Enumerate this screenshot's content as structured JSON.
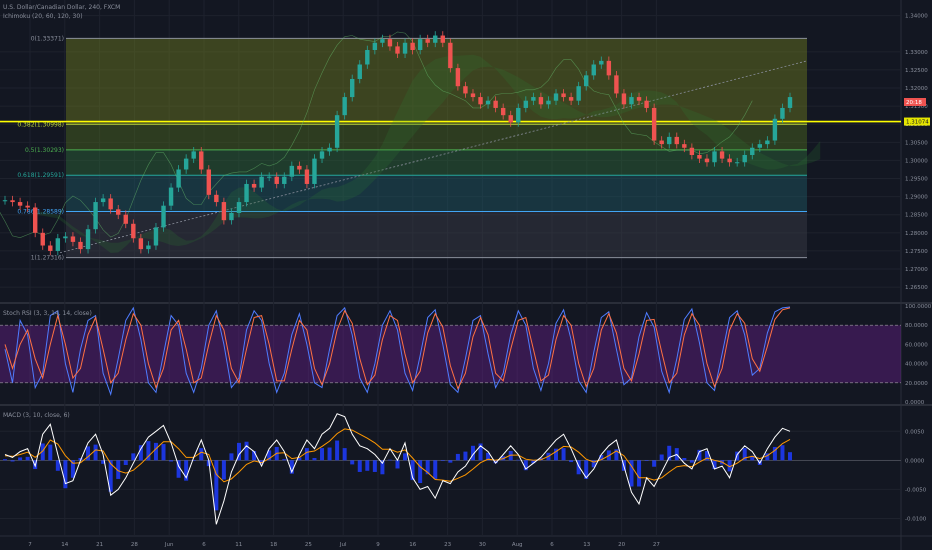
{
  "header": {
    "title": "U.S. Dollar/Canadian Dollar, 240, FXCM",
    "indicator": "Ichimoku (20, 60, 120, 30)"
  },
  "panes": {
    "stoch_label": "Stoch RSI (3, 3, 14, 14, close)",
    "macd_label": "MACD (3, 10, close, 6)"
  },
  "price_tags": {
    "upper": "20:18",
    "current": "1.31074"
  },
  "colors": {
    "background": "#131722",
    "candle_up": "#26a69a",
    "candle_down": "#ef5350",
    "horizontal_line": "#ffff00",
    "stoch_band": "#7b1fa2",
    "macd_line": "#ffffff",
    "signal_line": "#ff9800",
    "histogram": "#1e3cff"
  },
  "chart_data": [
    {
      "type": "line",
      "title": "U.S. Dollar/Canadian Dollar, 240, FXCM",
      "y_axis_ticks": [
        "1.34000",
        "1.33000",
        "1.32500",
        "1.32000",
        "1.31500",
        "1.31000",
        "1.30500",
        "1.30000",
        "1.29500",
        "1.29000",
        "1.28500",
        "1.28000",
        "1.27500",
        "1.27000",
        "1.26500"
      ],
      "ylim": [
        1.262,
        1.341
      ],
      "x_axis_ticks": [
        "7",
        "14",
        "21",
        "28",
        "Jun",
        "6",
        "11",
        "18",
        "25",
        "Jul",
        "9",
        "16",
        "23",
        "30",
        "Aug",
        "6",
        "13",
        "20",
        "27"
      ],
      "fib_levels": [
        {
          "label": "0(1.33371)",
          "value": 1.33371,
          "color": "#8a8f9c"
        },
        {
          "label": "0.382(1.30998)",
          "value": 1.30998,
          "color": "#bcd63a"
        },
        {
          "label": "0.5(1.30293)",
          "value": 1.30293,
          "color": "#4caf50"
        },
        {
          "label": "0.618(1.29591)",
          "value": 1.29591,
          "color": "#26a69a"
        },
        {
          "label": "0.786(1.28589)",
          "value": 1.28589,
          "color": "#42a5f5"
        },
        {
          "label": "1(1.27316)",
          "value": 1.27316,
          "color": "#8a8f9c"
        }
      ],
      "horizontal_line": 1.31074,
      "price_series": [
        1.289,
        1.2885,
        1.2875,
        1.287,
        1.28,
        1.2765,
        1.275,
        1.2785,
        1.279,
        1.2775,
        1.2755,
        1.281,
        1.2885,
        1.2895,
        1.2865,
        1.285,
        1.2825,
        1.2785,
        1.2755,
        1.2765,
        1.2815,
        1.2875,
        1.2925,
        1.2975,
        1.3005,
        1.3025,
        1.2975,
        1.2905,
        1.2885,
        1.2835,
        1.2855,
        1.2885,
        1.2935,
        1.2925,
        1.2955,
        1.2955,
        1.2935,
        1.2955,
        1.2985,
        1.2975,
        1.2935,
        1.3005,
        1.3025,
        1.3035,
        1.3125,
        1.3175,
        1.3225,
        1.3265,
        1.3305,
        1.3325,
        1.3335,
        1.3315,
        1.3295,
        1.3325,
        1.3305,
        1.3335,
        1.3325,
        1.3345,
        1.3325,
        1.3255,
        1.3205,
        1.3185,
        1.3175,
        1.3155,
        1.3165,
        1.3145,
        1.3125,
        1.3105,
        1.3145,
        1.3165,
        1.3175,
        1.3155,
        1.3165,
        1.3185,
        1.3175,
        1.3165,
        1.3205,
        1.3235,
        1.3265,
        1.3275,
        1.3235,
        1.3185,
        1.3155,
        1.3175,
        1.3165,
        1.3145,
        1.3055,
        1.3045,
        1.3065,
        1.3045,
        1.3035,
        1.3015,
        1.3005,
        1.2995,
        1.3025,
        1.3005,
        1.2995,
        1.2995,
        1.3015,
        1.3035,
        1.3045,
        1.3055,
        1.3115,
        1.3145,
        1.3175
      ]
    },
    {
      "type": "line",
      "title": "Stoch RSI (3, 3, 14, 14, close)",
      "y_axis_ticks": [
        "100.0000",
        "80.0000",
        "60.0000",
        "40.0000",
        "20.0000",
        "0.0000"
      ],
      "ylim": [
        0,
        100
      ],
      "band": [
        20,
        80
      ],
      "series": [
        {
          "name": "K",
          "color": "#4f7cff",
          "values": [
            55,
            20,
            85,
            70,
            15,
            30,
            90,
            95,
            40,
            10,
            55,
            85,
            90,
            30,
            8,
            45,
            85,
            98,
            65,
            20,
            10,
            50,
            90,
            80,
            30,
            10,
            35,
            80,
            95,
            60,
            15,
            25,
            75,
            95,
            85,
            40,
            10,
            30,
            70,
            92,
            60,
            20,
            15,
            55,
            90,
            98,
            70,
            25,
            10,
            40,
            80,
            95,
            75,
            30,
            12,
            48,
            88,
            96,
            60,
            18,
            10,
            45,
            85,
            90,
            50,
            15,
            30,
            70,
            95,
            80,
            35,
            12,
            40,
            82,
            96,
            65,
            22,
            10,
            52,
            88,
            94,
            55,
            18,
            25,
            68,
            93,
            78,
            32,
            10,
            45,
            86,
            97,
            62,
            20,
            12,
            50,
            88,
            95,
            70,
            28,
            35,
            72,
            94,
            98,
            99
          ]
        },
        {
          "name": "D",
          "color": "#ff7043",
          "values": [
            60,
            35,
            60,
            75,
            45,
            25,
            60,
            90,
            60,
            25,
            35,
            70,
            88,
            55,
            20,
            30,
            65,
            92,
            80,
            40,
            15,
            35,
            75,
            85,
            55,
            20,
            25,
            60,
            90,
            75,
            35,
            20,
            55,
            88,
            90,
            60,
            22,
            22,
            55,
            85,
            75,
            35,
            18,
            40,
            75,
            95,
            82,
            45,
            18,
            28,
            65,
            90,
            85,
            50,
            20,
            32,
            72,
            92,
            78,
            38,
            14,
            30,
            68,
            88,
            70,
            30,
            22,
            55,
            85,
            88,
            55,
            22,
            28,
            65,
            90,
            80,
            40,
            16,
            35,
            75,
            92,
            72,
            35,
            22,
            50,
            85,
            86,
            52,
            20,
            30,
            70,
            92,
            80,
            40,
            16,
            35,
            75,
            92,
            82,
            45,
            32,
            58,
            86,
            96,
            98
          ]
        }
      ]
    },
    {
      "type": "line",
      "title": "MACD (3, 10, close, 6)",
      "y_axis_ticks": [
        "0.0050",
        "0.0000",
        "-0.0050",
        "-0.0100"
      ],
      "ylim": [
        -0.0125,
        0.009
      ],
      "series": [
        {
          "name": "MACD",
          "color": "#ffffff",
          "values": [
            0.001,
            0.0005,
            0.0015,
            0.002,
            -0.001,
            0.0045,
            0.0062,
            0.001,
            -0.004,
            -0.0035,
            0.0,
            0.003,
            0.0045,
            0.001,
            -0.006,
            -0.005,
            -0.003,
            -0.0005,
            0.002,
            0.004,
            0.005,
            0.006,
            0.003,
            -0.001,
            -0.003,
            0.0005,
            0.0035,
            0.0,
            -0.011,
            -0.007,
            -0.002,
            0.001,
            0.0025,
            0.0015,
            -0.001,
            0.002,
            0.0035,
            0.0015,
            -0.002,
            0.001,
            0.0035,
            0.002,
            0.0045,
            0.0055,
            0.008,
            0.0075,
            0.0045,
            0.0025,
            0.002,
            0.001,
            -0.0005,
            0.002,
            0.0,
            0.003,
            -0.003,
            -0.005,
            -0.0045,
            -0.0065,
            -0.0035,
            -0.004,
            -0.002,
            -0.001,
            0.001,
            0.0025,
            0.0015,
            -0.0005,
            0.001,
            0.0025,
            0.001,
            -0.0015,
            -0.0005,
            0.0005,
            0.002,
            0.0035,
            0.0045,
            0.002,
            -0.001,
            -0.003,
            -0.0015,
            0.001,
            0.0025,
            0.0035,
            -0.001,
            -0.0055,
            -0.0075,
            -0.003,
            -0.0045,
            -0.002,
            0.0005,
            0.001,
            -0.0005,
            -0.0015,
            0.0015,
            0.002,
            -0.0015,
            -0.001,
            -0.003,
            0.001,
            0.0025,
            0.0015,
            -0.0005,
            0.002,
            0.004,
            0.0055,
            0.005
          ]
        },
        {
          "name": "Signal",
          "color": "#ff9800",
          "values": [
            0.0008,
            0.0007,
            0.001,
            0.0014,
            0.0005,
            0.0016,
            0.0035,
            0.0028,
            0.0008,
            -0.0005,
            -0.0004,
            0.0006,
            0.0018,
            0.0016,
            -0.0006,
            -0.0018,
            -0.0022,
            -0.0017,
            -0.0006,
            0.0007,
            0.002,
            0.0032,
            0.0032,
            0.002,
            0.0005,
            0.0005,
            0.0014,
            0.001,
            -0.0024,
            -0.0037,
            -0.0032,
            -0.002,
            -0.0007,
            -0.0001,
            -0.0004,
            0.0003,
            0.0012,
            0.0013,
            0.0003,
            0.0005,
            0.0014,
            0.0016,
            0.0024,
            0.0033,
            0.0046,
            0.0054,
            0.0052,
            0.0045,
            0.0038,
            0.003,
            0.0019,
            0.0019,
            0.0014,
            0.0018,
            0.0004,
            -0.0011,
            -0.0021,
            -0.0033,
            -0.0034,
            -0.0036,
            -0.0031,
            -0.0025,
            -0.0015,
            -0.0004,
            0.0002,
            0.0,
            0.0003,
            0.0009,
            0.0009,
            0.0002,
            0.0,
            0.0001,
            0.0007,
            0.0015,
            0.0024,
            0.0023,
            0.0014,
            0.0002,
            -0.0003,
            0.0001,
            0.0008,
            0.0016,
            0.0008,
            -0.001,
            -0.003,
            -0.003,
            -0.0034,
            -0.003,
            -0.002,
            -0.0011,
            -0.0009,
            -0.0011,
            -0.0003,
            0.0004,
            0.0,
            -0.0003,
            -0.0011,
            -0.0005,
            0.0004,
            0.0007,
            0.0003,
            0.0008,
            0.0017,
            0.0029,
            0.0036
          ]
        },
        {
          "name": "Histogram",
          "color": "#1e3cff",
          "values": [
            0.0002,
            -0.0002,
            0.0005,
            0.0006,
            -0.0015,
            0.0029,
            0.0027,
            -0.0018,
            -0.0048,
            -0.003,
            0.0004,
            0.0024,
            0.0027,
            -0.0006,
            -0.0054,
            -0.0032,
            -0.0008,
            0.0012,
            0.0026,
            0.0033,
            0.003,
            0.0028,
            -0.0002,
            -0.003,
            -0.0035,
            0.0,
            0.0021,
            -0.001,
            -0.0086,
            -0.0033,
            0.0012,
            0.003,
            0.0032,
            0.0016,
            -0.0006,
            0.0017,
            0.0023,
            0.0002,
            -0.0023,
            0.0005,
            0.0021,
            0.0004,
            0.0021,
            0.0022,
            0.0034,
            0.0021,
            -0.0007,
            -0.002,
            -0.0018,
            -0.002,
            -0.0024,
            0.0001,
            -0.0014,
            0.0012,
            -0.0034,
            -0.0039,
            -0.0024,
            -0.0032,
            -0.0001,
            -0.0004,
            0.0011,
            0.0015,
            0.0025,
            0.0029,
            0.0013,
            -0.0005,
            0.0007,
            0.0016,
            0.0001,
            -0.0017,
            -0.0005,
            0.0004,
            0.0013,
            0.002,
            0.0021,
            -0.0003,
            -0.0024,
            -0.0032,
            -0.0012,
            0.0009,
            0.0017,
            0.0019,
            -0.0018,
            -0.0045,
            -0.0045,
            0.0,
            -0.0011,
            0.001,
            0.0025,
            0.0021,
            0.0004,
            -0.0004,
            0.0018,
            0.0016,
            -0.0015,
            -0.0007,
            -0.0019,
            0.0015,
            0.0021,
            0.0008,
            -0.0008,
            0.0012,
            0.0023,
            0.0026,
            0.0014
          ]
        }
      ]
    }
  ]
}
